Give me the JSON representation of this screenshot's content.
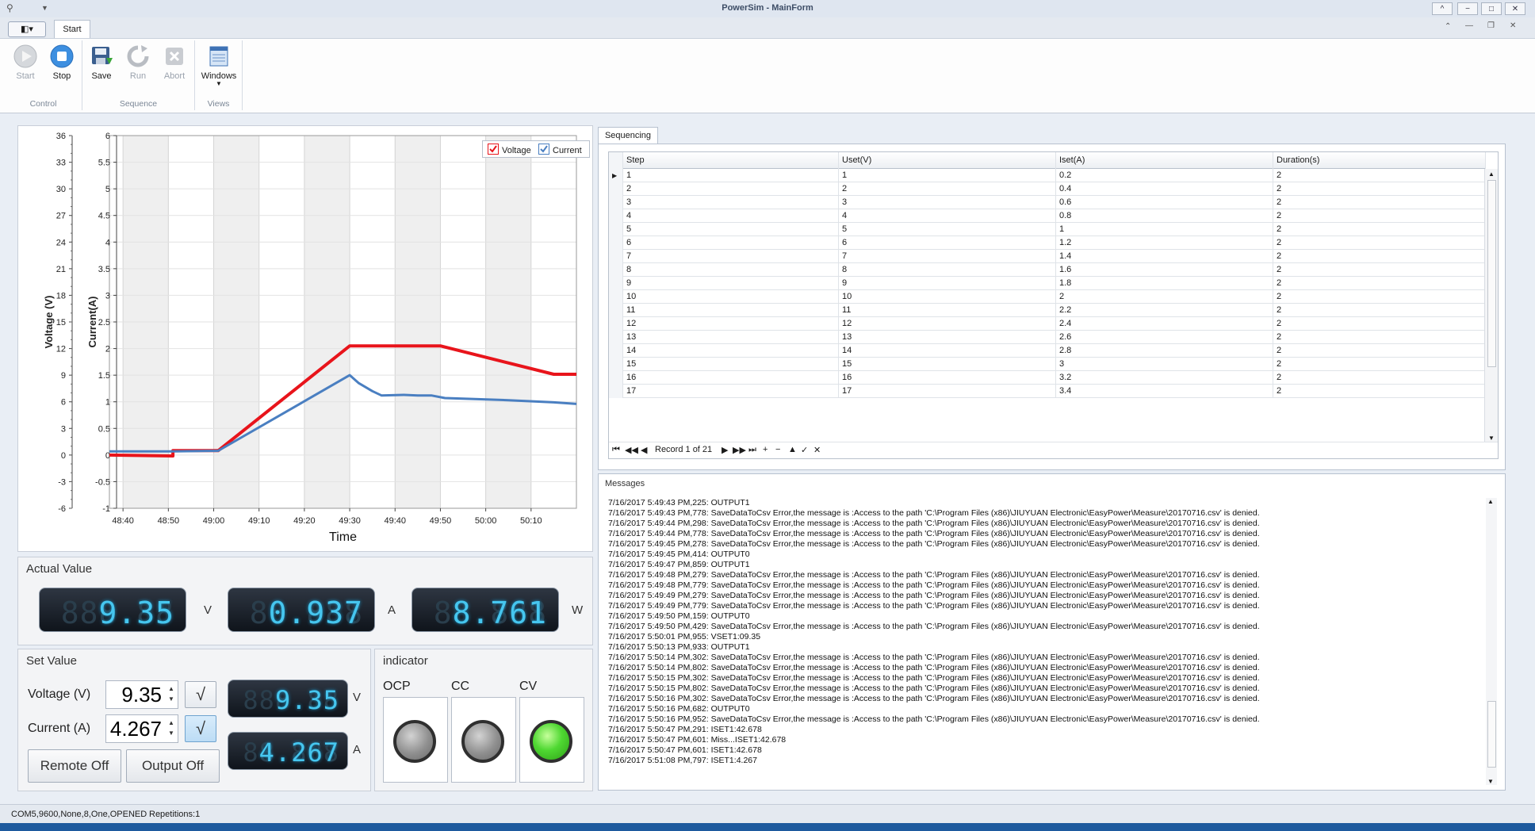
{
  "window": {
    "title": "PowerSim - MainForm",
    "controls": {
      "minimize": "−",
      "maximize": "□",
      "close": "✕",
      "help": "^"
    }
  },
  "ribbon": {
    "app_menu": "◧▾",
    "tab": "Start",
    "groups": [
      {
        "label": "Control",
        "buttons": [
          {
            "label": "Start",
            "icon": "play-icon",
            "enabled": false
          },
          {
            "label": "Stop",
            "icon": "stop-icon",
            "enabled": true
          }
        ]
      },
      {
        "label": "Sequence",
        "buttons": [
          {
            "label": "Save",
            "icon": "save-icon",
            "enabled": true
          },
          {
            "label": "Run",
            "icon": "refresh-icon",
            "enabled": false
          },
          {
            "label": "Abort",
            "icon": "abort-icon",
            "enabled": false
          }
        ]
      },
      {
        "label": "Views",
        "buttons": [
          {
            "label": "Windows",
            "icon": "windows-icon",
            "enabled": true
          }
        ]
      }
    ]
  },
  "chart_data": {
    "type": "line",
    "xlabel": "Time",
    "x_ticks": [
      "48:40",
      "48:50",
      "49:00",
      "49:10",
      "49:20",
      "49:30",
      "49:40",
      "49:50",
      "50:00",
      "50:10"
    ],
    "y_left": {
      "label": "Voltage (V)",
      "ticks": [
        -6,
        -3,
        0,
        3,
        6,
        9,
        12,
        15,
        18,
        21,
        24,
        27,
        30,
        33,
        36
      ],
      "range": [
        -6,
        36
      ]
    },
    "y_right": {
      "label": "Current(A)",
      "ticks": [
        -1,
        -0.5,
        0,
        0.5,
        1,
        1.5,
        2,
        2.5,
        3,
        3.5,
        4,
        4.5,
        5,
        5.5,
        6
      ],
      "range": [
        -1,
        6
      ]
    },
    "x_range_seconds": [
      2917,
      3020
    ],
    "legend": {
      "position": "top-right",
      "entries": [
        {
          "name": "Voltage",
          "color": "#e8141b",
          "checked": true
        },
        {
          "name": "Current",
          "color": "#4a7fc1",
          "checked": true
        }
      ]
    },
    "grid": true,
    "series": [
      {
        "name": "Voltage",
        "axis": "left",
        "color": "#e8141b",
        "x": [
          "48:37",
          "48:51",
          "48:51",
          "49:01",
          "49:30",
          "49:50",
          "50:15",
          "50:20"
        ],
        "y": [
          0,
          -0.1,
          0.5,
          0.5,
          12.3,
          12.3,
          9.1,
          9.1
        ]
      },
      {
        "name": "Current",
        "axis": "right",
        "color": "#4a7fc1",
        "x": [
          "48:37",
          "48:51",
          "49:01",
          "49:30",
          "49:32",
          "49:35",
          "49:37",
          "49:42",
          "49:45",
          "49:48",
          "49:51",
          "49:55",
          "50:05",
          "50:15",
          "50:20"
        ],
        "y": [
          0.07,
          0.07,
          0.08,
          1.5,
          1.35,
          1.2,
          1.12,
          1.13,
          1.12,
          1.12,
          1.07,
          1.06,
          1.03,
          0.99,
          0.96
        ]
      }
    ]
  },
  "actual": {
    "title": "Actual Value",
    "voltage": {
      "value": "9.35",
      "ghost": "888.88",
      "unit": "V"
    },
    "current": {
      "value": "0.937",
      "ghost": "88.888",
      "unit": "A"
    },
    "power": {
      "value": "8.761",
      "ghost": "88.888",
      "unit": "W"
    }
  },
  "setvalue": {
    "title": "Set Value",
    "voltage_label": "Voltage (V)",
    "voltage_value": "9.35",
    "current_label": "Current (A)",
    "current_value": "4.267",
    "ok_symbol": "√",
    "voltage_display": {
      "value": "9.35",
      "ghost": "888.88",
      "unit": "V"
    },
    "current_display": {
      "value": "4.267",
      "ghost": "88.888",
      "unit": "A"
    },
    "remote_button": "Remote Off",
    "output_button": "Output Off"
  },
  "indicator": {
    "title": "indicator",
    "items": [
      {
        "label": "OCP",
        "on": false
      },
      {
        "label": "CC",
        "on": false
      },
      {
        "label": "CV",
        "on": true
      }
    ]
  },
  "sequencing": {
    "tab": "Sequencing",
    "columns": [
      "Step",
      "Uset(V)",
      "Iset(A)",
      "Duration(s)"
    ],
    "rows": [
      [
        "1",
        "1",
        "0.2",
        "2"
      ],
      [
        "2",
        "2",
        "0.4",
        "2"
      ],
      [
        "3",
        "3",
        "0.6",
        "2"
      ],
      [
        "4",
        "4",
        "0.8",
        "2"
      ],
      [
        "5",
        "5",
        "1",
        "2"
      ],
      [
        "6",
        "6",
        "1.2",
        "2"
      ],
      [
        "7",
        "7",
        "1.4",
        "2"
      ],
      [
        "8",
        "8",
        "1.6",
        "2"
      ],
      [
        "9",
        "9",
        "1.8",
        "2"
      ],
      [
        "10",
        "10",
        "2",
        "2"
      ],
      [
        "11",
        "11",
        "2.2",
        "2"
      ],
      [
        "12",
        "12",
        "2.4",
        "2"
      ],
      [
        "13",
        "13",
        "2.6",
        "2"
      ],
      [
        "14",
        "14",
        "2.8",
        "2"
      ],
      [
        "15",
        "15",
        "3",
        "2"
      ],
      [
        "16",
        "16",
        "3.2",
        "2"
      ],
      [
        "17",
        "17",
        "3.4",
        "2"
      ]
    ],
    "current_row": 1,
    "nav": {
      "first": "⏮",
      "prev_page": "◀◀",
      "prev": "◀",
      "record_text": "Record 1 of 21",
      "next": "▶",
      "next_page": "▶▶",
      "last": "⏭",
      "add": "+",
      "remove": "−",
      "up": "▲",
      "check": "✓",
      "cancel": "✕"
    }
  },
  "messages": {
    "title": "Messages",
    "lines": [
      "7/16/2017 5:49:43 PM,225: OUTPUT1",
      "7/16/2017 5:49:43 PM,778: SaveDataToCsv Error,the message is :Access to the path 'C:\\Program Files (x86)\\JIUYUAN Electronic\\EasyPower\\Measure\\20170716.csv' is denied.",
      "7/16/2017 5:49:44 PM,298: SaveDataToCsv Error,the message is :Access to the path 'C:\\Program Files (x86)\\JIUYUAN Electronic\\EasyPower\\Measure\\20170716.csv' is denied.",
      "7/16/2017 5:49:44 PM,778: SaveDataToCsv Error,the message is :Access to the path 'C:\\Program Files (x86)\\JIUYUAN Electronic\\EasyPower\\Measure\\20170716.csv' is denied.",
      "7/16/2017 5:49:45 PM,278: SaveDataToCsv Error,the message is :Access to the path 'C:\\Program Files (x86)\\JIUYUAN Electronic\\EasyPower\\Measure\\20170716.csv' is denied.",
      "7/16/2017 5:49:45 PM,414: OUTPUT0",
      "7/16/2017 5:49:47 PM,859: OUTPUT1",
      "7/16/2017 5:49:48 PM,279: SaveDataToCsv Error,the message is :Access to the path 'C:\\Program Files (x86)\\JIUYUAN Electronic\\EasyPower\\Measure\\20170716.csv' is denied.",
      "7/16/2017 5:49:48 PM,779: SaveDataToCsv Error,the message is :Access to the path 'C:\\Program Files (x86)\\JIUYUAN Electronic\\EasyPower\\Measure\\20170716.csv' is denied.",
      "7/16/2017 5:49:49 PM,279: SaveDataToCsv Error,the message is :Access to the path 'C:\\Program Files (x86)\\JIUYUAN Electronic\\EasyPower\\Measure\\20170716.csv' is denied.",
      "7/16/2017 5:49:49 PM,779: SaveDataToCsv Error,the message is :Access to the path 'C:\\Program Files (x86)\\JIUYUAN Electronic\\EasyPower\\Measure\\20170716.csv' is denied.",
      "7/16/2017 5:49:50 PM,159: OUTPUT0",
      "7/16/2017 5:49:50 PM,429: SaveDataToCsv Error,the message is :Access to the path 'C:\\Program Files (x86)\\JIUYUAN Electronic\\EasyPower\\Measure\\20170716.csv' is denied.",
      "7/16/2017 5:50:01 PM,955: VSET1:09.35",
      "7/16/2017 5:50:13 PM,933: OUTPUT1",
      "7/16/2017 5:50:14 PM,302: SaveDataToCsv Error,the message is :Access to the path 'C:\\Program Files (x86)\\JIUYUAN Electronic\\EasyPower\\Measure\\20170716.csv' is denied.",
      "7/16/2017 5:50:14 PM,802: SaveDataToCsv Error,the message is :Access to the path 'C:\\Program Files (x86)\\JIUYUAN Electronic\\EasyPower\\Measure\\20170716.csv' is denied.",
      "7/16/2017 5:50:15 PM,302: SaveDataToCsv Error,the message is :Access to the path 'C:\\Program Files (x86)\\JIUYUAN Electronic\\EasyPower\\Measure\\20170716.csv' is denied.",
      "7/16/2017 5:50:15 PM,802: SaveDataToCsv Error,the message is :Access to the path 'C:\\Program Files (x86)\\JIUYUAN Electronic\\EasyPower\\Measure\\20170716.csv' is denied.",
      "7/16/2017 5:50:16 PM,302: SaveDataToCsv Error,the message is :Access to the path 'C:\\Program Files (x86)\\JIUYUAN Electronic\\EasyPower\\Measure\\20170716.csv' is denied.",
      "7/16/2017 5:50:16 PM,682: OUTPUT0",
      "7/16/2017 5:50:16 PM,952: SaveDataToCsv Error,the message is :Access to the path 'C:\\Program Files (x86)\\JIUYUAN Electronic\\EasyPower\\Measure\\20170716.csv' is denied.",
      "7/16/2017 5:50:47 PM,291: ISET1:42.678",
      "7/16/2017 5:50:47 PM,601: Miss...ISET1:42.678",
      "7/16/2017 5:50:47 PM,601: ISET1:42.678",
      "7/16/2017 5:51:08 PM,797: ISET1:4.267"
    ]
  },
  "status": {
    "port": "COM5,9600,None,8,One,OPENED",
    "repetitions": "Repetitions:1"
  }
}
